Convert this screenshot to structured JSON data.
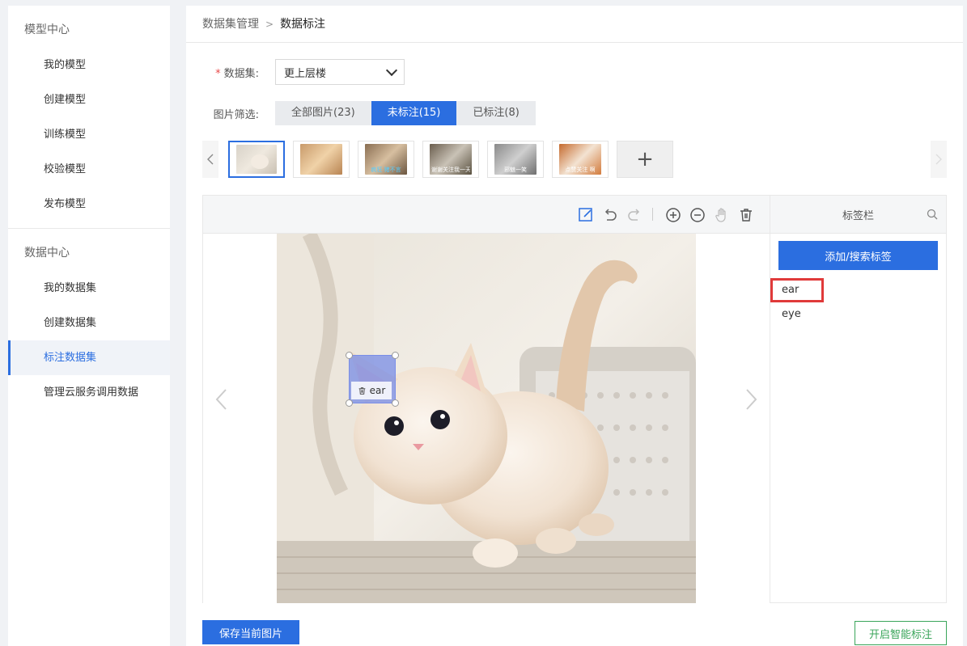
{
  "sidebar": {
    "groups": [
      {
        "title": "模型中心",
        "items": [
          "我的模型",
          "创建模型",
          "训练模型",
          "校验模型",
          "发布模型"
        ]
      },
      {
        "title": "数据中心",
        "items": [
          "我的数据集",
          "创建数据集",
          "标注数据集",
          "管理云服务调用数据"
        ]
      }
    ],
    "active_item": "标注数据集"
  },
  "breadcrumb": {
    "parent": "数据集管理",
    "separator": ">",
    "current": "数据标注"
  },
  "dataset": {
    "label": "数据集:",
    "value": "更上层楼"
  },
  "filter": {
    "label": "图片筛选:",
    "options": [
      "全部图片(23)",
      "未标注(15)",
      "已标注(8)"
    ],
    "active": 1
  },
  "thumbnails": [
    {
      "caption": ""
    },
    {
      "caption": ""
    },
    {
      "caption": "疯狂 猪不言"
    },
    {
      "caption": "谢谢关注我一天的"
    },
    {
      "caption": "邪魅一笑"
    },
    {
      "caption": "点赞关注 啊"
    }
  ],
  "annotation": {
    "box_label": "ear"
  },
  "tag_panel": {
    "title": "标签栏",
    "add_button": "添加/搜索标签",
    "tags": [
      "ear",
      "eye"
    ]
  },
  "actions": {
    "save": "保存当前图片",
    "smart": "开启智能标注"
  },
  "colors": {
    "accent": "#2b6ee0",
    "green": "#3aa55a",
    "highlight": "#e03a3a"
  }
}
